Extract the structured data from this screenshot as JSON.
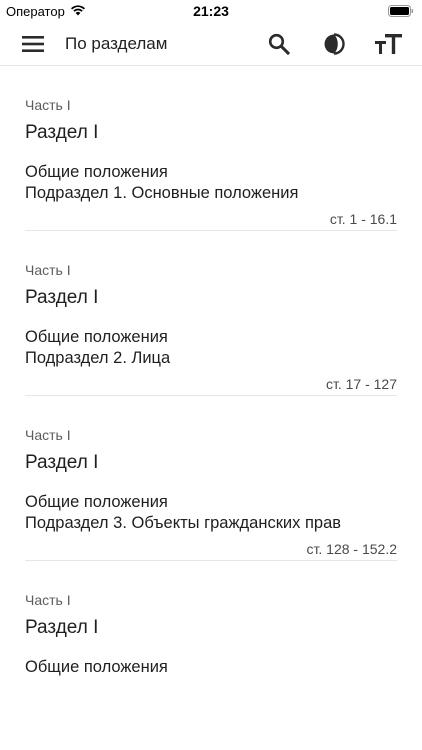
{
  "status_bar": {
    "carrier": "Оператор",
    "time": "21:23"
  },
  "app_bar": {
    "title": "По разделам",
    "icons": [
      "menu-icon",
      "search-icon",
      "contrast-icon",
      "text-size-icon"
    ]
  },
  "sections": [
    {
      "part": "Часть I",
      "title": "Раздел I",
      "subtitle": "Общие положения",
      "subsection": "Подраздел 1. Основные положения",
      "articles": "ст. 1 - 16.1"
    },
    {
      "part": "Часть I",
      "title": "Раздел I",
      "subtitle": "Общие положения",
      "subsection": "Подраздел 2. Лица",
      "articles": "ст. 17 - 127"
    },
    {
      "part": "Часть I",
      "title": "Раздел I",
      "subtitle": "Общие положения",
      "subsection": "Подраздел 3. Объекты гражданских прав",
      "articles": "ст. 128 - 152.2"
    },
    {
      "part": "Часть I",
      "title": "Раздел I",
      "subtitle": "Общие положения",
      "subsection": "",
      "articles": ""
    }
  ]
}
